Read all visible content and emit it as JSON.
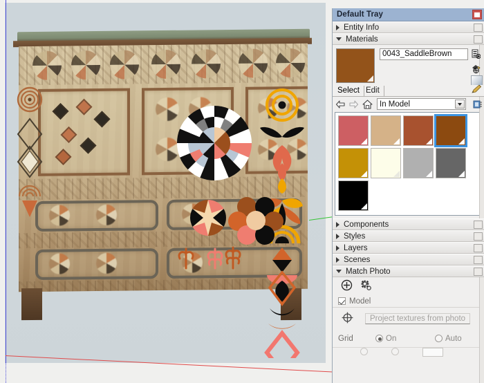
{
  "tray": {
    "title": "Default Tray",
    "close_icon": "close-icon",
    "sections": [
      {
        "id": "entity-info",
        "label": "Entity Info",
        "expanded": false
      },
      {
        "id": "materials",
        "label": "Materials",
        "expanded": true
      },
      {
        "id": "components",
        "label": "Components",
        "expanded": false
      },
      {
        "id": "styles",
        "label": "Styles",
        "expanded": false
      },
      {
        "id": "layers",
        "label": "Layers",
        "expanded": false
      },
      {
        "id": "scenes",
        "label": "Scenes",
        "expanded": false
      },
      {
        "id": "match-photo",
        "label": "Match Photo",
        "expanded": true
      }
    ]
  },
  "materials": {
    "current_name": "0043_SaddleBrown",
    "current_color": "#93531a",
    "tabs": [
      {
        "label": "Select",
        "active": true
      },
      {
        "label": "Edit",
        "active": false
      }
    ],
    "library_value": "In Model",
    "nav": {
      "back_icon": "arrow-left-icon",
      "forward_icon": "arrow-right-icon",
      "home_icon": "home-icon",
      "details_icon": "details-menu-icon",
      "dropdown_icon": "chevron-down-icon"
    },
    "side_icons": [
      {
        "name": "create-material-icon"
      },
      {
        "name": "sample-paint-icon"
      }
    ],
    "edit_icon": "pencil-icon",
    "swatches": [
      {
        "name": "swatch-dusty-rose",
        "color": "#cd5f63",
        "selected": false,
        "light": false
      },
      {
        "name": "swatch-tan",
        "color": "#d5b288",
        "selected": false,
        "light": false
      },
      {
        "name": "swatch-sienna",
        "color": "#a8522f",
        "selected": false,
        "light": false
      },
      {
        "name": "swatch-saddlebrown",
        "color": "#8c4a10",
        "selected": true,
        "light": false
      },
      {
        "name": "swatch-goldenrod",
        "color": "#c49106",
        "selected": false,
        "light": false
      },
      {
        "name": "swatch-ivory",
        "color": "#fdfde9",
        "selected": false,
        "light": true
      },
      {
        "name": "swatch-silver",
        "color": "#b0b0b0",
        "selected": false,
        "light": false
      },
      {
        "name": "swatch-dimgray",
        "color": "#666666",
        "selected": false,
        "light": false
      },
      {
        "name": "swatch-black",
        "color": "#000000",
        "selected": false,
        "light": false
      }
    ]
  },
  "match_photo": {
    "add_icon": "add-matched-photo-icon",
    "settings_icon": "settings-gear-icon",
    "model_checkbox_label": "Model",
    "model_checked": true,
    "project_icon": "project-target-icon",
    "project_button_label": "Project textures from photo",
    "grid_label": "Grid",
    "grid_options": [
      {
        "label": "On",
        "selected": true
      },
      {
        "label": "Auto",
        "selected": false
      }
    ]
  },
  "viewport": {
    "axes": {
      "red": "#e04a4a",
      "green": "#35c435",
      "blue": "#4b4bdc"
    },
    "photo_subject": "painted antique chest of drawers",
    "background_color": "#f0f0ee",
    "overlay_colors": {
      "coral": "#ef7d70",
      "orange": "#d2642a",
      "gold": "#f0a500",
      "black": "#0a0a0a",
      "white": "#ffffff",
      "gray": "#808080",
      "bluegray": "#b8c6d4",
      "peach": "#f0cba1",
      "brown": "#9b4f1d"
    }
  }
}
